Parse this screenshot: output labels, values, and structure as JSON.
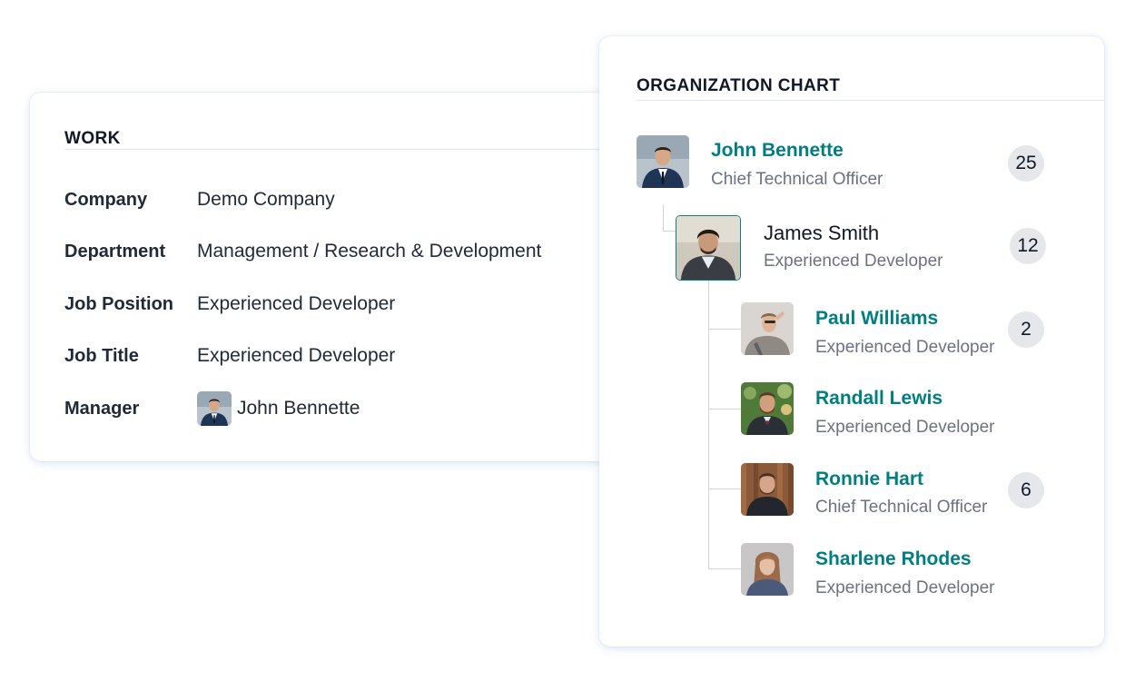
{
  "work": {
    "title": "WORK",
    "fields": [
      {
        "label": "Company",
        "value": "Demo Company"
      },
      {
        "label": "Department",
        "value": "Management / Research & Development"
      },
      {
        "label": "Job Position",
        "value": "Experienced Developer"
      },
      {
        "label": "Job Title",
        "value": "Experienced Developer"
      },
      {
        "label": "Manager",
        "value": "John Bennette"
      }
    ]
  },
  "org_chart": {
    "title": "ORGANIZATION CHART",
    "manager": {
      "name": "John Bennette",
      "job": "Chief Technical Officer",
      "count": "25"
    },
    "self": {
      "name": "James Smith",
      "job": "Experienced Developer",
      "count": "12"
    },
    "subordinates": [
      {
        "name": "Paul Williams",
        "job": "Experienced Developer",
        "count": "2"
      },
      {
        "name": "Randall Lewis",
        "job": "Experienced Developer",
        "count": ""
      },
      {
        "name": "Ronnie Hart",
        "job": "Chief Technical Officer",
        "count": "6"
      },
      {
        "name": "Sharlene Rhodes",
        "job": "Experienced Developer",
        "count": ""
      }
    ]
  },
  "colors": {
    "accent": "#017e84",
    "muted": "#6b7280",
    "badge_bg": "#e5e7eb"
  },
  "icons": {
    "avatar": "person-photo-avatar"
  }
}
